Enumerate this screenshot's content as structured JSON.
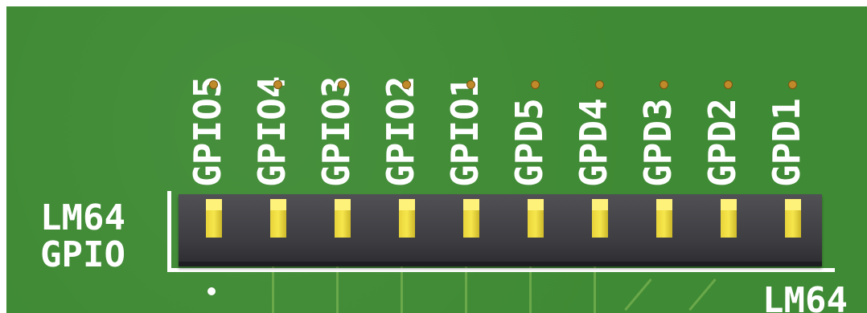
{
  "board": {
    "pin_labels": [
      "GPIO5",
      "GPIO4",
      "GPIO3",
      "GPIO2",
      "GPIO1",
      "GPD5",
      "GPD4",
      "GPD3",
      "GPD2",
      "GPD1"
    ],
    "side_label_top": "LM64",
    "side_label_bottom": "GPIO",
    "corner_label": "LM64",
    "colors": {
      "pcb_green": "#3f8a34",
      "silkscreen": "#ffffff",
      "header_body": "#3c3c41",
      "pin_gold": "#f0e040"
    }
  }
}
